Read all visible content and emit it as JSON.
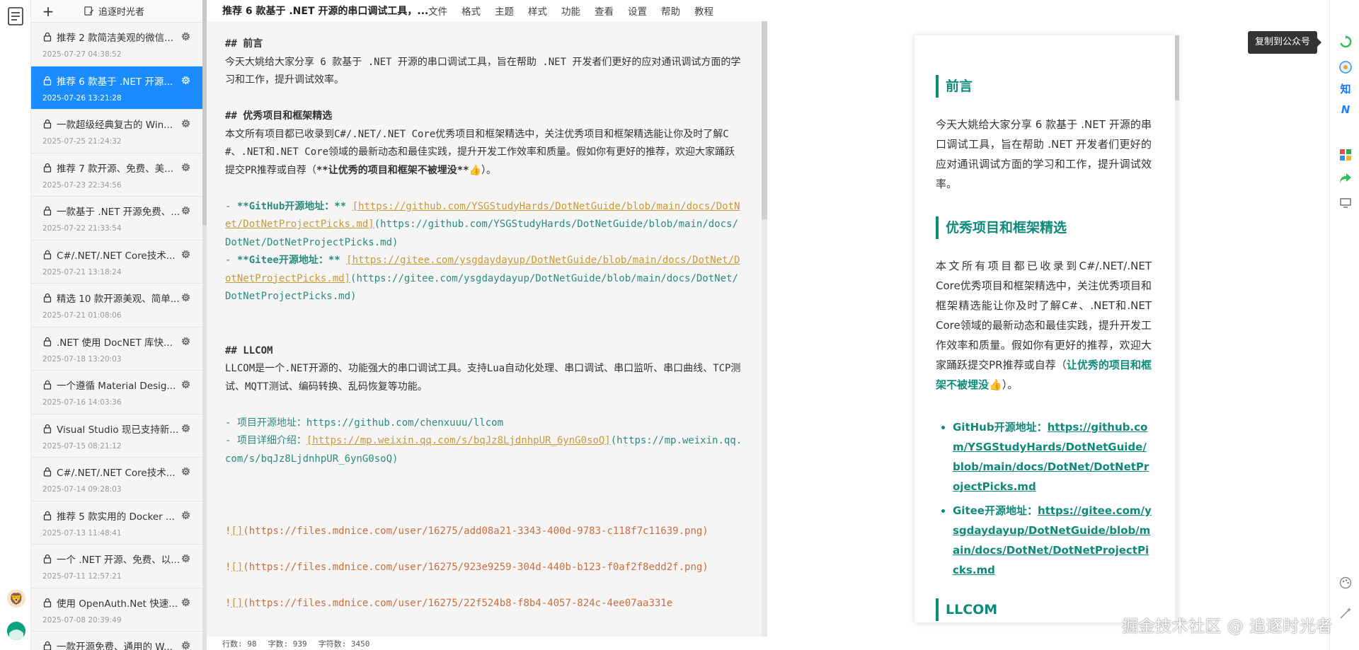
{
  "sidebar": {
    "add_label": "+",
    "user_name": "追逐时光者",
    "articles": [
      {
        "title": "推荐 2 款简洁美观的微信...",
        "date": "2025-07-27 04:38:52",
        "active": false
      },
      {
        "title": "推荐 6 款基于 .NET 开源...",
        "date": "2025-07-26 13:21:28",
        "active": true
      },
      {
        "title": "一款超级经典复古的 Win...",
        "date": "2025-07-25 21:24:32",
        "active": false
      },
      {
        "title": "推荐 7 款开源、免费、美...",
        "date": "2025-07-23 22:34:56",
        "active": false
      },
      {
        "title": "一款基于 .NET 开源免费、...",
        "date": "2025-07-22 21:33:54",
        "active": false
      },
      {
        "title": "C#/.NET/.NET Core技术...",
        "date": "2025-07-21 13:18:24",
        "active": false
      },
      {
        "title": "精选 10 款开源美观、简单...",
        "date": "2025-07-21 01:08:06",
        "active": false
      },
      {
        "title": ".NET 使用 DocNET 库快...",
        "date": "2025-07-18 13:20:03",
        "active": false
      },
      {
        "title": "一个遵循 Material Desig...",
        "date": "2025-07-16 14:03:36",
        "active": false
      },
      {
        "title": "Visual Studio 现已支持新...",
        "date": "2025-07-15 08:21:12",
        "active": false
      },
      {
        "title": "C#/.NET/.NET Core技术...",
        "date": "2025-07-14 09:28:03",
        "active": false
      },
      {
        "title": "推荐 5 款实用的 Docker ...",
        "date": "2025-07-13 11:48:41",
        "active": false
      },
      {
        "title": "一个 .NET 开源、免费、以...",
        "date": "2025-07-11 12:57:21",
        "active": false
      },
      {
        "title": "使用 OpenAuth.Net 快速...",
        "date": "2025-07-08 20:39:49",
        "active": false
      },
      {
        "title": "一款开源免费、通用的 W...",
        "date": "",
        "active": false
      }
    ]
  },
  "menubar": {
    "doc_title": "推荐 6 款基于 .NET 开源的串口调试工具，...",
    "items": [
      "文件",
      "格式",
      "主题",
      "样式",
      "功能",
      "查看",
      "设置",
      "帮助",
      "教程"
    ]
  },
  "editor": {
    "lines": [
      [
        {
          "c": "h",
          "t": "## 前言"
        }
      ],
      [
        {
          "c": "",
          "t": "今天大姚给大家分享 6 款基于 .NET 开源的串口调试工具，旨在帮助 .NET 开发者们更好的应对通讯调试方面的学习和工作，提升调试效率。"
        }
      ],
      [],
      [
        {
          "c": "h",
          "t": "## 优秀项目和框架精选"
        }
      ],
      [
        {
          "c": "",
          "t": "本文所有项目都已收录到C#/.NET/.NET Core优秀项目和框架精选中，关注优秀项目和框架精选能让你及时了解C#、.NET和.NET Core领域的最新动态和最佳实践，提升开发工作效率和质量。假如你有更好的推荐，欢迎大家踊跃提交PR推荐或自荐（"
        },
        {
          "c": "b",
          "t": "**让优秀的项目和框架不被埋没**"
        },
        {
          "c": "",
          "t": "👍）。"
        }
      ],
      [],
      [
        {
          "c": "g",
          "t": "- "
        },
        {
          "c": "b g",
          "t": "**GitHub开源地址：** "
        },
        {
          "c": "u",
          "t": "[https://github.com/YSGStudyHards/DotNetGuide/blob/main/docs/DotNet/DotNetProjectPicks.md]"
        },
        {
          "c": "g",
          "t": "(https://github.com/YSGStudyHards/DotNetGuide/blob/main/docs/DotNet/DotNetProjectPicks.md)"
        }
      ],
      [
        {
          "c": "g",
          "t": "- "
        },
        {
          "c": "b g",
          "t": "**Gitee开源地址：** "
        },
        {
          "c": "u",
          "t": "[https://gitee.com/ysgdaydayup/DotNetGuide/blob/main/docs/DotNet/DotNetProjectPicks.md]"
        },
        {
          "c": "g",
          "t": "(https://gitee.com/ysgdaydayup/DotNetGuide/blob/main/docs/DotNet/DotNetProjectPicks.md)"
        }
      ],
      [],
      [],
      [
        {
          "c": "h",
          "t": "## LLCOM"
        }
      ],
      [
        {
          "c": "",
          "t": "LLCOM是一个.NET开源的、功能强大的串口调试工具。支持Lua自动化处理、串口调试、串口监听、串口曲线、TCP测试、MQTT测试、编码转换、乱码恢复等功能。"
        }
      ],
      [],
      [
        {
          "c": "g",
          "t": "- 项目开源地址：https://github.com/chenxuuu/llcom"
        }
      ],
      [
        {
          "c": "g",
          "t": "- 项目详细介绍："
        },
        {
          "c": "u",
          "t": "[https://mp.weixin.qq.com/s/bqJz8LjdnhpUR_6ynG0soQ]"
        },
        {
          "c": "g",
          "t": "(https://mp.weixin.qq.com/s/bqJz8LjdnhpUR_6ynG0soQ)"
        }
      ],
      [],
      [],
      [],
      [
        {
          "c": "o",
          "t": "!"
        },
        {
          "c": "u",
          "t": "[]"
        },
        {
          "c": "o",
          "t": "(https://files.mdnice.com/user/16275/add08a21-3343-400d-9783-c118f7c11639.png)"
        }
      ],
      [],
      [
        {
          "c": "o",
          "t": "!"
        },
        {
          "c": "u",
          "t": "[]"
        },
        {
          "c": "o",
          "t": "(https://files.mdnice.com/user/16275/923e9259-304d-440b-b123-f0af2f8edd2f.png)"
        }
      ],
      [],
      [
        {
          "c": "o",
          "t": "!"
        },
        {
          "c": "u",
          "t": "[]"
        },
        {
          "c": "o",
          "t": "(https://files.mdnice.com/user/16275/22f524b8-f8b4-4057-824c-4ee07aa331e"
        }
      ]
    ]
  },
  "status": {
    "lines": "行数: 98",
    "words": "字数: 939",
    "chars": "字符数: 3450"
  },
  "preview": {
    "h_intro": "前言",
    "p_intro": "今天大姚给大家分享 6 款基于 .NET 开源的串口调试工具，旨在帮助 .NET 开发者们更好的应对通讯调试方面的学习和工作，提升调试效率。",
    "h_picks": "优秀项目和框架精选",
    "p_picks": "本文所有项目都已收录到C#/.NET/.NET Core优秀项目和框架精选中，关注优秀项目和框架精选能让你及时了解C#、.NET和.NET Core领域的最新动态和最佳实践，提升开发工作效率和质量。假如你有更好的推荐，欢迎大家踊跃提交PR推荐或自荐（",
    "p_picks_hl": "让优秀的项目和框架不被埋没👍",
    "p_picks_end": "）。",
    "github_label": "GitHub开源地址：",
    "github_url": "https://github.com/YSGStudyHards/DotNetGuide/blob/main/docs/DotNet/DotNetProjectPicks.md",
    "gitee_label": "Gitee开源地址：",
    "gitee_url": "https://gitee.com/ysgdaydayup/DotNetGuide/blob/main/docs/DotNet/DotNetProjectPicks.md",
    "h_llcom": "LLCOM"
  },
  "tooltip": "复制到公众号",
  "right_rail": {
    "zhihu_label": "知",
    "juejin_label": "N"
  },
  "watermark": "掘金技术社区 @ 追逐时光者",
  "colors": {
    "accent": "#1a8cff",
    "theme": "#0f8a7a"
  }
}
